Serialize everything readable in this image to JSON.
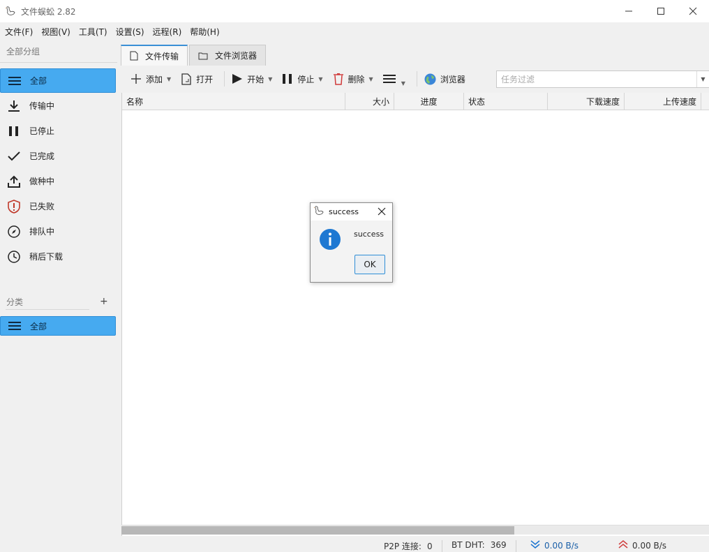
{
  "window": {
    "title": "文件蜈蚣 2.82"
  },
  "menu": [
    "文件(F)",
    "视图(V)",
    "工具(T)",
    "设置(S)",
    "远程(R)",
    "帮助(H)"
  ],
  "sidebar": {
    "group_header": "全部分组",
    "items": [
      {
        "label": "全部",
        "icon": "list-icon",
        "active": true
      },
      {
        "label": "传输中",
        "icon": "download-icon"
      },
      {
        "label": "已停止",
        "icon": "pause-icon"
      },
      {
        "label": "已完成",
        "icon": "check-icon"
      },
      {
        "label": "做种中",
        "icon": "upload-icon"
      },
      {
        "label": "已失败",
        "icon": "shield-alert-icon"
      },
      {
        "label": "排队中",
        "icon": "compass-icon"
      },
      {
        "label": "稍后下载",
        "icon": "clock-icon"
      }
    ],
    "category_header": "分类",
    "category_add": "+",
    "categories": [
      {
        "label": "全部",
        "icon": "list-icon",
        "active": true
      }
    ]
  },
  "tabs": [
    {
      "label": "文件传输",
      "icon": "file-icon",
      "active": true
    },
    {
      "label": "文件浏览器",
      "icon": "folder-icon",
      "active": false
    }
  ],
  "toolbar": {
    "add": "添加",
    "open": "打开",
    "start": "开始",
    "stop": "停止",
    "delete": "删除",
    "browser": "浏览器",
    "filter_placeholder": "任务过滤"
  },
  "table": {
    "columns": [
      "名称",
      "大小",
      "进度",
      "状态",
      "下载速度",
      "上传速度"
    ],
    "rows": []
  },
  "status": {
    "p2p_label": "P2P 连接:",
    "p2p_value": "0",
    "dht_label": "BT DHT:",
    "dht_value": "369",
    "down_speed": "0.00 B/s",
    "up_speed": "0.00 B/s"
  },
  "dialog": {
    "title": "success",
    "message": "success",
    "ok": "OK"
  },
  "colors": {
    "accent": "#46aaf0",
    "accent_border": "#2f8ed6",
    "info_icon": "#1e78d2",
    "down_arrow": "#1a74d0",
    "up_arrow": "#d04040"
  }
}
